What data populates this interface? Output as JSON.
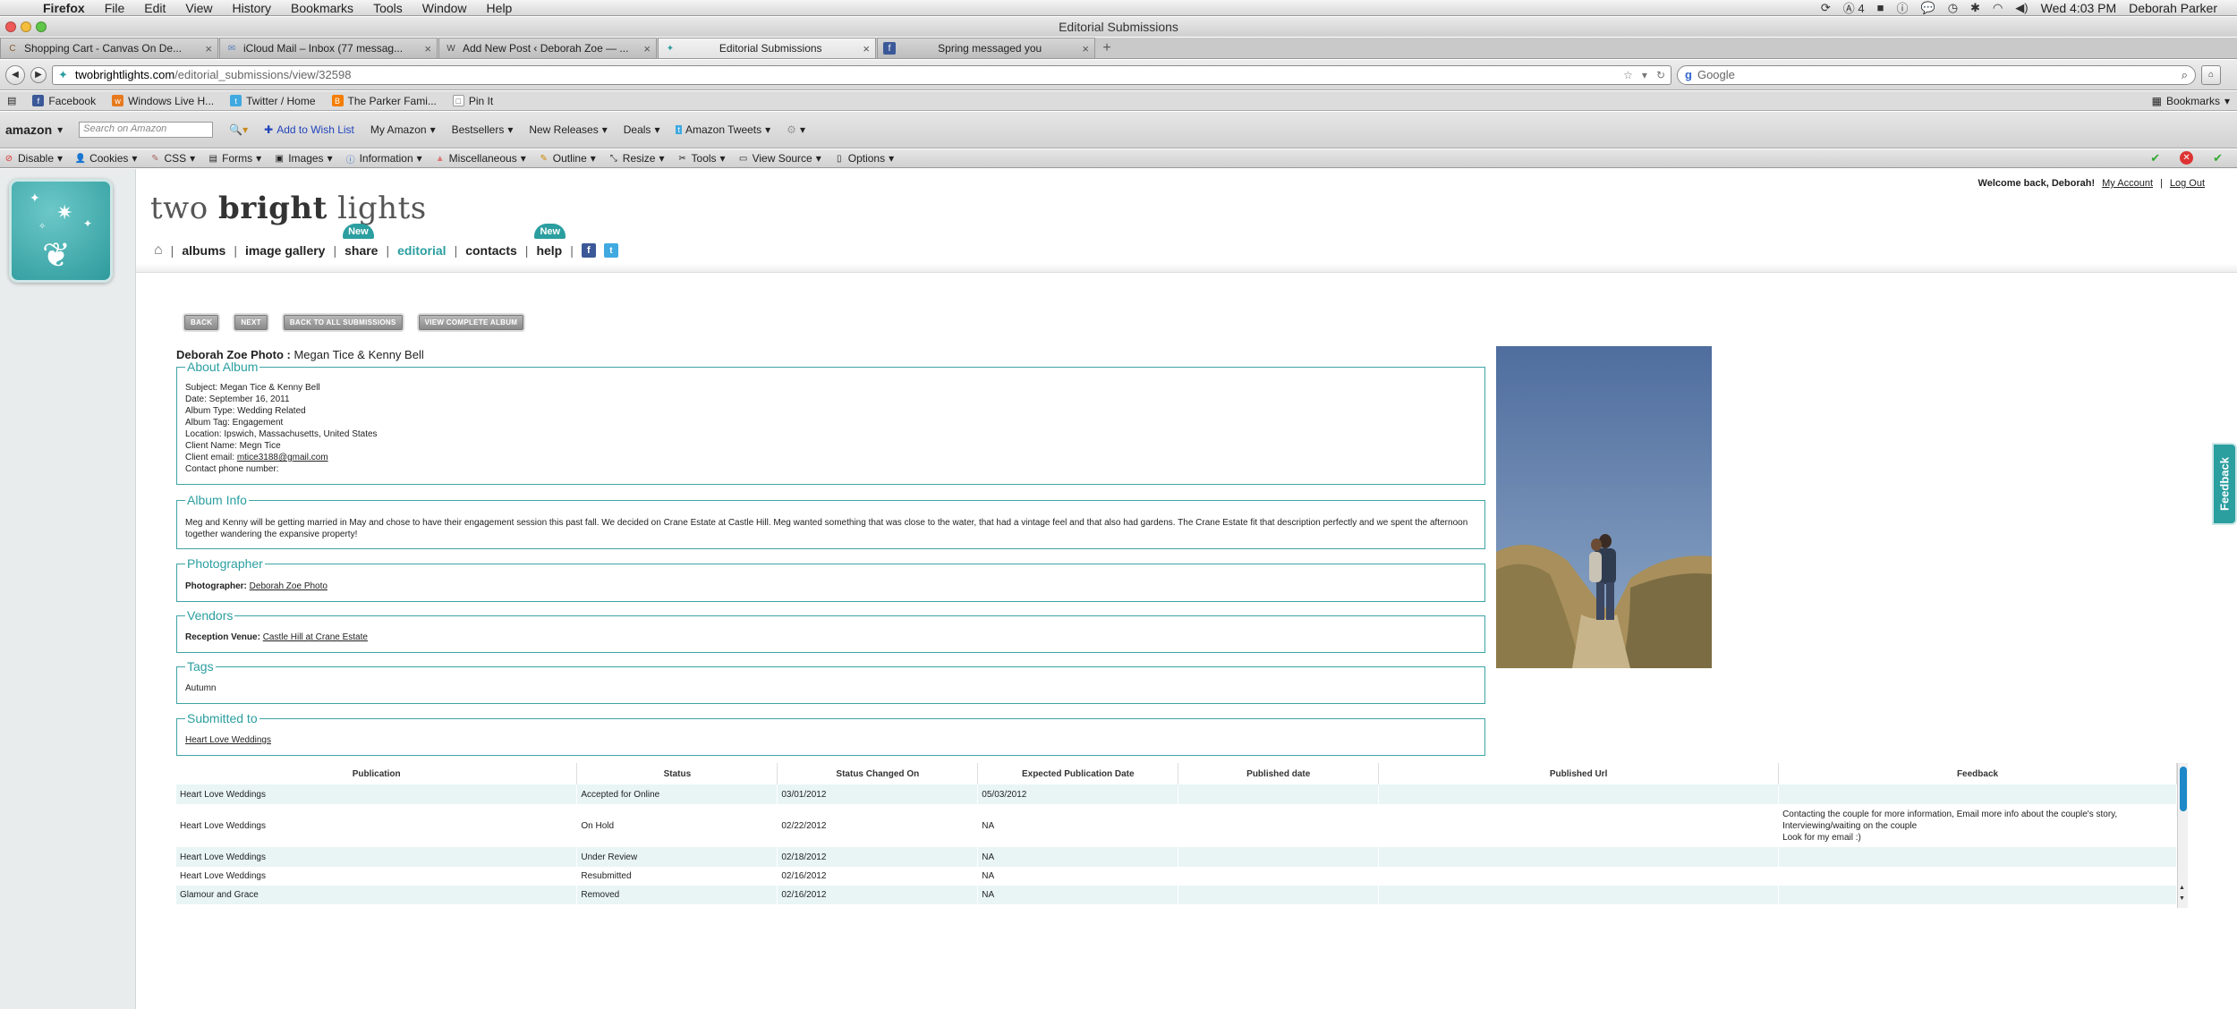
{
  "menubar": {
    "app": "Firefox",
    "items": [
      "File",
      "Edit",
      "View",
      "History",
      "Bookmarks",
      "Tools",
      "Window",
      "Help"
    ],
    "status_count": "4",
    "clock": "Wed 4:03 PM",
    "user": "Deborah Parker"
  },
  "window": {
    "title": "Editorial Submissions"
  },
  "tabs": [
    {
      "label": "Shopping Cart - Canvas On De...",
      "icon": "C",
      "color": "#8a5a2b"
    },
    {
      "label": "iCloud Mail – Inbox (77 messag...",
      "icon": "✉",
      "color": "#5a7fbf"
    },
    {
      "label": "Add New Post ‹ Deborah Zoe — ...",
      "icon": "W",
      "color": "#444444"
    },
    {
      "label": "Editorial Submissions",
      "icon": "✦",
      "color": "#2b9ea0"
    },
    {
      "label": "Spring messaged you",
      "icon": "f",
      "color": "#3b5998"
    }
  ],
  "url": {
    "host": "twobrightlights.com",
    "path": "/editorial_submissions/view/32598"
  },
  "search": {
    "placeholder": "Google"
  },
  "bookmarks": [
    {
      "label": "Facebook",
      "icon": "f",
      "color": "#3b5998"
    },
    {
      "label": "Windows Live H...",
      "icon": "w",
      "color": "#e87a1e"
    },
    {
      "label": "Twitter / Home",
      "icon": "t",
      "color": "#3fa9e0"
    },
    {
      "label": "The Parker Fami...",
      "icon": "B",
      "color": "#f57d00"
    },
    {
      "label": "Pin It",
      "icon": "□",
      "color": "#ffffff"
    }
  ],
  "bookmarks_menu": "Bookmarks",
  "amazon": {
    "logo": "amazon",
    "search_placeholder": "Search on Amazon",
    "items": [
      "Add to Wish List",
      "My Amazon",
      "Bestsellers",
      "New Releases",
      "Deals",
      "Amazon Tweets"
    ]
  },
  "devbar": [
    "Disable",
    "Cookies",
    "CSS",
    "Forms",
    "Images",
    "Information",
    "Miscellaneous",
    "Outline",
    "Resize",
    "Tools",
    "View Source",
    "Options"
  ],
  "site": {
    "welcome": "Welcome back, Deborah!",
    "my_account": "My Account",
    "logout": "Log Out",
    "brand_light1": "two ",
    "brand_bold": "bright",
    "brand_light2": " lights",
    "nav": {
      "albums": "albums",
      "gallery": "image gallery",
      "share": "share",
      "editorial": "editorial",
      "contacts": "contacts",
      "help": "help",
      "new_badge": "New",
      "facebook_icon": "f",
      "twitter_icon": "t"
    },
    "buttons": [
      "BACK",
      "NEXT",
      "BACK TO ALL SUBMISSIONS",
      "VIEW COMPLETE ALBUM"
    ],
    "photographer_title": "Deborah Zoe Photo :",
    "album_title": "Megan Tice & Kenny Bell",
    "about": {
      "legend": "About Album",
      "subject": "Subject: Megan Tice & Kenny Bell",
      "date": "Date: September 16, 2011",
      "type": "Album Type: Wedding Related",
      "tag": "Album Tag: Engagement",
      "location": "Location: Ipswich, Massachusetts, United States",
      "client": "Client Name: Megn Tice",
      "email_label": "Client email:",
      "email": "mtice3188@gmail.com",
      "phone": "Contact phone number:"
    },
    "info": {
      "legend": "Album Info",
      "text": "Meg and Kenny will be getting married in May and chose to have their engagement session this past fall. We decided on Crane Estate at Castle Hill. Meg wanted something that was close to the water, that had a vintage feel and that also had gardens. The Crane Estate fit that description perfectly and we spent the afternoon together wandering the expansive property!"
    },
    "photographer": {
      "legend": "Photographer",
      "label": "Photographer:",
      "value": "Deborah Zoe Photo"
    },
    "vendors": {
      "legend": "Vendors",
      "label": "Reception Venue:",
      "value": "Castle Hill at Crane Estate"
    },
    "tags": {
      "legend": "Tags",
      "value": "Autumn"
    },
    "submitted": {
      "legend": "Submitted to",
      "value": "Heart Love Weddings"
    },
    "feedback_tab": "Feedback"
  },
  "table": {
    "headers": [
      "Publication",
      "Status",
      "Status Changed On",
      "Expected Publication Date",
      "Published date",
      "Published Url",
      "Feedback"
    ],
    "rows": [
      {
        "publication": "Heart Love Weddings",
        "status": "Accepted for Online",
        "changed": "03/01/2012",
        "expected": "05/03/2012",
        "published": "",
        "url": "",
        "feedback1": "",
        "feedback2": "",
        "feedback3": ""
      },
      {
        "publication": "Heart Love Weddings",
        "status": "On Hold",
        "changed": "02/22/2012",
        "expected": "NA",
        "published": "",
        "url": "",
        "feedback1": "Contacting the couple for more information, Email more info about the couple's story,",
        "feedback2": "Interviewing/waiting on the couple",
        "feedback3": "Look for my email :)"
      },
      {
        "publication": "Heart Love Weddings",
        "status": "Under Review",
        "changed": "02/18/2012",
        "expected": "NA",
        "published": "",
        "url": "",
        "feedback1": "",
        "feedback2": "",
        "feedback3": ""
      },
      {
        "publication": "Heart Love Weddings",
        "status": "Resubmitted",
        "changed": "02/16/2012",
        "expected": "NA",
        "published": "",
        "url": "",
        "feedback1": "",
        "feedback2": "",
        "feedback3": ""
      },
      {
        "publication": "Glamour and Grace",
        "status": "Removed",
        "changed": "02/16/2012",
        "expected": "NA",
        "published": "",
        "url": "",
        "feedback1": "",
        "feedback2": "",
        "feedback3": ""
      }
    ]
  },
  "colors": {
    "accent": "#2b9ea0",
    "row_alt": "#e9f5f5"
  }
}
